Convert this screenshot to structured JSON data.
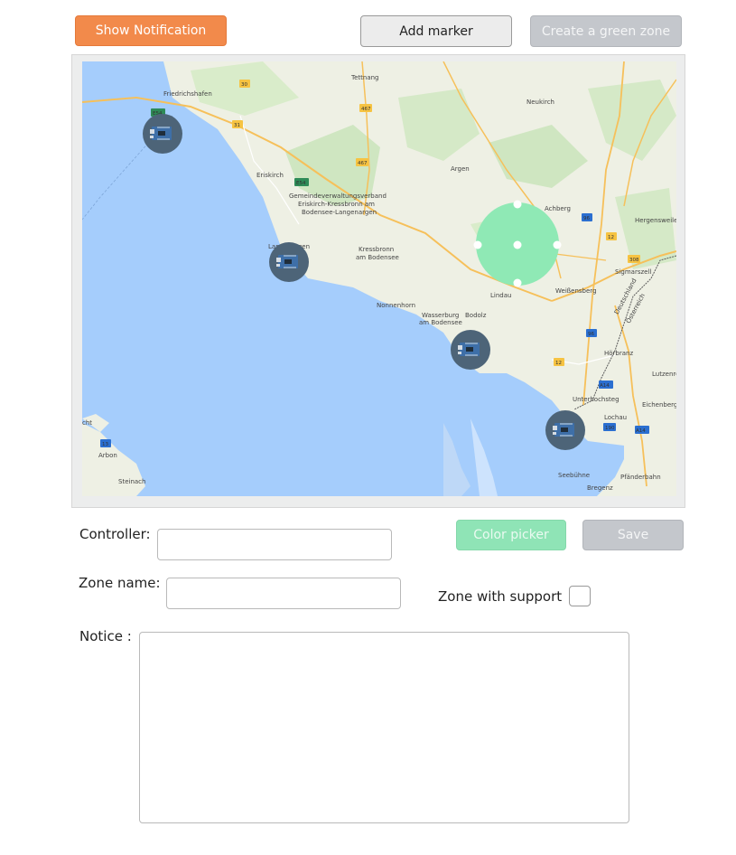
{
  "toolbar": {
    "show_notification": "Show Notification",
    "add_marker": "Add marker",
    "create_green_zone": "Create a green zone"
  },
  "map": {
    "places": {
      "friedrichshafen": "Friedrichshafen",
      "tettnang": "Tettnang",
      "neukirch": "Neukirch",
      "eriskirch": "Eriskirch",
      "gemeinde1": "Gemeindeverwaltungsverband",
      "gemeinde2": "Eriskirch-Kressbronn am",
      "gemeinde3": "Bodensee-Langenargen",
      "argen": "Argen",
      "achberg": "Achberg",
      "hergensweiler": "Hergensweiler",
      "langenargen": "Langenargen",
      "kressbronn1": "Kressbronn",
      "kressbronn2": "am Bodensee",
      "nonnenhorn": "Nonnenhorn",
      "wasserburg1": "Wasserburg",
      "wasserburg2": "am Bodensee",
      "bodolz": "Bodolz",
      "lindau": "Lindau",
      "weissensberg": "Weißensberg",
      "sigmarszell": "Sigmarszell",
      "hörbranz": "Hörbranz",
      "lutzenre": "Lutzenre",
      "unterhochsteg": "Unterhochsteg",
      "eichenberg": "Eichenberg",
      "lochau": "Lochau",
      "arbon": "Arbon",
      "steinach": "Steinach",
      "seebuehne": "Seebühne",
      "pfaenderbahn": "Pfänderbahn",
      "bregenz": "Bregenz",
      "cht": "cht",
      "deutschland": "Deutschland",
      "osterreich": "Österreich"
    },
    "roads": [
      "467",
      "30",
      "31",
      "E54",
      "E54",
      "467",
      "96",
      "12",
      "308",
      "96",
      "12",
      "A14",
      "A14",
      "190",
      "13",
      "L333",
      "L329",
      "L320",
      "308",
      "31",
      "L11"
    ],
    "markers": [
      "controller-marker",
      "controller-marker",
      "controller-marker",
      "controller-marker"
    ],
    "zone_color": "#8fe9b5"
  },
  "form": {
    "controller_label": "Controller:",
    "controller_value": "",
    "zone_name_label": "Zone name:",
    "zone_name_value": "",
    "color_picker": "Color picker",
    "save": "Save",
    "zone_support_label": "Zone with support",
    "zone_support_checked": false,
    "notice_label": "Notice :",
    "notice_value": ""
  }
}
